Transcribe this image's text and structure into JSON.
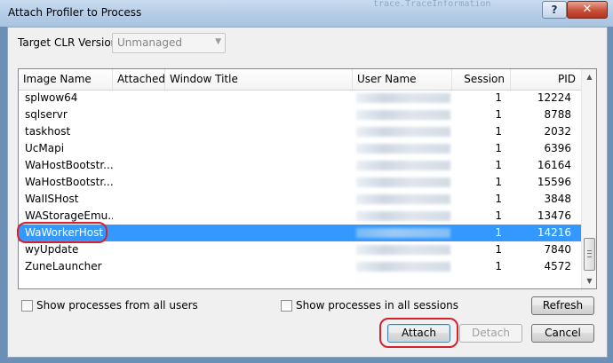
{
  "window": {
    "title": "Attach Profiler to Process",
    "background_text": "trace.TraceInformation",
    "help_label": "?",
    "close_label": "✕"
  },
  "clr": {
    "label": "Target CLR Version:",
    "value": "Unmanaged"
  },
  "table": {
    "columns": {
      "image_name": "Image Name",
      "attached": "Attached",
      "window_title": "Window Title",
      "user_name": "User Name",
      "session": "Session",
      "pid": "PID"
    },
    "rows": [
      {
        "name": "splwow64",
        "session": "1",
        "pid": "12224"
      },
      {
        "name": "sqlservr",
        "session": "1",
        "pid": "8788"
      },
      {
        "name": "taskhost",
        "session": "1",
        "pid": "2032"
      },
      {
        "name": "UcMapi",
        "session": "1",
        "pid": "6396"
      },
      {
        "name": "WaHostBootstr...",
        "session": "1",
        "pid": "16164"
      },
      {
        "name": "WaHostBootstr...",
        "session": "1",
        "pid": "15596"
      },
      {
        "name": "WaIISHost",
        "session": "1",
        "pid": "3848"
      },
      {
        "name": "WAStorageEmu...",
        "session": "1",
        "pid": "13476"
      },
      {
        "name": "WaWorkerHost",
        "session": "1",
        "pid": "14216",
        "selected": true
      },
      {
        "name": "wyUpdate",
        "session": "1",
        "pid": "7840"
      },
      {
        "name": "ZuneLauncher",
        "session": "1",
        "pid": "4572"
      }
    ]
  },
  "options": {
    "all_users": "Show processes from all users",
    "all_sessions": "Show processes in all sessions"
  },
  "buttons": {
    "refresh": "Refresh",
    "attach": "Attach",
    "detach": "Detach",
    "cancel": "Cancel"
  },
  "colors": {
    "selection": "#3399ff",
    "highlight_ring": "#d6222f"
  }
}
